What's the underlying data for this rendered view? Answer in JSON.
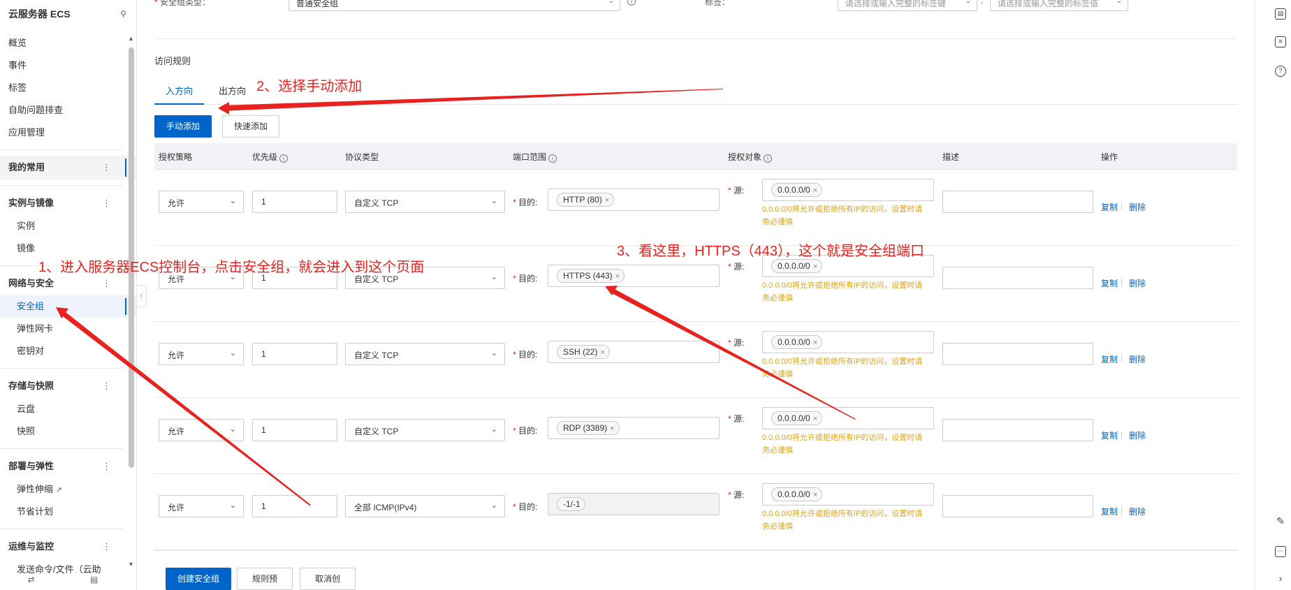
{
  "sidebar": {
    "title": "云服务器 ECS",
    "top_items": [
      "概览",
      "事件",
      "标签",
      "自助问题排查",
      "应用管理"
    ],
    "favorites": "我的常用",
    "groups": [
      {
        "label": "实例与镜像",
        "items": [
          "实例",
          "镜像"
        ]
      },
      {
        "label": "网络与安全",
        "items": [
          "安全组",
          "弹性网卡",
          "密钥对"
        ]
      },
      {
        "label": "存储与快照",
        "items": [
          "云盘",
          "快照"
        ]
      },
      {
        "label": "部署与弹性",
        "items": [
          "弹性伸缩",
          "节省计划"
        ]
      },
      {
        "label": "运维与监控",
        "items": [
          "发送命令/文件（云助"
        ]
      }
    ],
    "active_item": "安全组"
  },
  "top": {
    "type_label": "安全组类型：",
    "type_value": "普通安全组",
    "tag_label": "标签：",
    "tag_key_placeholder": "请选择或输入完整的标签键",
    "tag_value_placeholder": "请选择或输入完整的标签值"
  },
  "rules": {
    "title": "访问规则",
    "tabs": [
      "入方向",
      "出方向"
    ],
    "add_manual": "手动添加",
    "add_quick": "快速添加",
    "headers": [
      "授权策略",
      "优先级",
      "协议类型",
      "端口范围",
      "授权对象",
      "描述",
      "操作"
    ],
    "dest_label": "目的:",
    "src_label": "源:",
    "warning": "0.0.0.0/0将允许或拒绝所有IP的访问，设置时请务必谨慎",
    "copy": "复制",
    "delete": "删除",
    "rows": [
      {
        "policy": "允许",
        "priority": "1",
        "protocol": "自定义 TCP",
        "port": "HTTP (80)",
        "source": "0.0.0.0/0"
      },
      {
        "policy": "允许",
        "priority": "1",
        "protocol": "自定义 TCP",
        "port": "HTTPS (443)",
        "source": "0.0.0.0/0"
      },
      {
        "policy": "允许",
        "priority": "1",
        "protocol": "自定义 TCP",
        "port": "SSH (22)",
        "source": "0.0.0.0/0"
      },
      {
        "policy": "允许",
        "priority": "1",
        "protocol": "自定义 TCP",
        "port": "RDP (3389)",
        "source": "0.0.0.0/0"
      },
      {
        "policy": "允许",
        "priority": "1",
        "protocol": "全部 ICMP(IPv4)",
        "port": "-1/-1",
        "source": "0.0.0.0/0"
      }
    ]
  },
  "footer": {
    "create": "创建安全组",
    "preview": "规则预览",
    "cancel": "取消创建"
  },
  "annotations": {
    "a1": "1、进入服务器ECS控制台，点击安全组，就会进入到这个页面",
    "a2": "2、选择手动添加",
    "a3": "3、看这里，HTTPS（443），这个就是安全组端口"
  },
  "colors": {
    "primary": "#0064c8",
    "warning": "#e6a417",
    "annotation": "#e8221e"
  }
}
